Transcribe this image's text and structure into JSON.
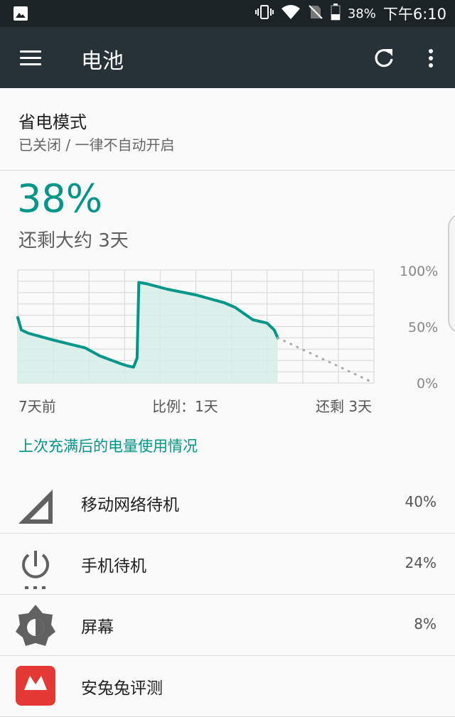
{
  "status": {
    "battery": "38%",
    "time": "下午6:10"
  },
  "appbar": {
    "title": "电池"
  },
  "power_saver": {
    "title": "省电模式",
    "subtitle": "已关闭 / 一律不自动开启"
  },
  "battery": {
    "percent": "38%",
    "remaining": "还剩大约 3天"
  },
  "chart": {
    "y_labels": [
      "100%",
      "50%",
      "0%"
    ],
    "x_labels": {
      "left": "7天前",
      "center": "比例：1天",
      "right": "还剩 3天"
    }
  },
  "chart_data": {
    "type": "line",
    "xlabel": "",
    "ylabel": "",
    "ylim": [
      0,
      100
    ],
    "x_range_days": [
      0,
      10
    ],
    "y_tick_labels": [
      "0%",
      "50%",
      "100%"
    ],
    "grid": true,
    "series": [
      {
        "x": [
          0,
          0.1,
          0.3,
          1.0,
          1.9,
          2.3,
          2.9,
          3.1,
          3.25,
          3.35,
          3.4,
          3.6,
          4.2,
          5.0,
          5.8,
          6.1,
          6.6,
          7.0,
          7.2,
          7.3
        ],
        "y": [
          58,
          47,
          44,
          38,
          31,
          24,
          17,
          15,
          14,
          22,
          89,
          88,
          83,
          78,
          71,
          67,
          56,
          53,
          47,
          40
        ]
      },
      {
        "x": [
          7.3,
          10.0
        ],
        "y": [
          40,
          0
        ]
      }
    ]
  },
  "usage": {
    "header": "上次充满后的电量使用情况",
    "items": [
      {
        "label": "移动网络待机",
        "value": "40%",
        "icon": "cell-signal-icon"
      },
      {
        "label": "手机待机",
        "value": "24%",
        "icon": "phone-idle-icon"
      },
      {
        "label": "屏幕",
        "value": "8%",
        "icon": "screen-brightness-icon"
      },
      {
        "label": "安兔兔评测",
        "value": "",
        "icon": "antutu-app-icon"
      }
    ]
  },
  "colors": {
    "accent": "#009688",
    "appbar": "#263238",
    "statusbar": "#1c2327"
  }
}
